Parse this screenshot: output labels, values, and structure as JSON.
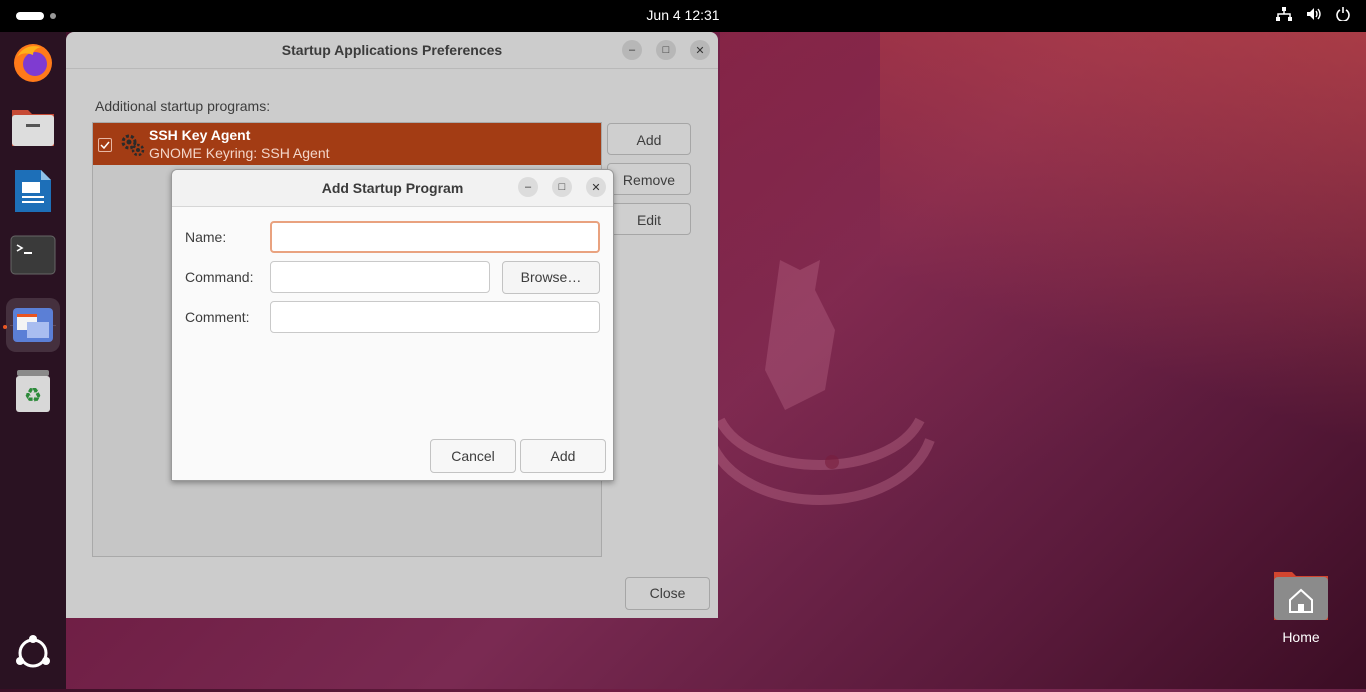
{
  "topbar": {
    "clock": "Jun 4  12:31",
    "tray_icons": [
      "network-icon",
      "volume-icon",
      "power-icon"
    ]
  },
  "dock": {
    "items": [
      {
        "name": "firefox-icon"
      },
      {
        "name": "files-icon"
      },
      {
        "name": "libreoffice-writer-icon"
      },
      {
        "name": "terminal-icon"
      },
      {
        "name": "startup-applications-icon",
        "running": true
      },
      {
        "name": "trash-icon"
      },
      {
        "name": "show-apps-icon"
      }
    ]
  },
  "main_window": {
    "title": "Startup Applications Preferences",
    "section_label": "Additional startup programs:",
    "programs": [
      {
        "name": "SSH Key Agent",
        "description": "GNOME Keyring: SSH Agent",
        "enabled": true,
        "selected": true
      }
    ],
    "buttons": {
      "add": "Add",
      "remove": "Remove",
      "edit": "Edit",
      "close": "Close"
    }
  },
  "dialog": {
    "title": "Add Startup Program",
    "name_label": "Name:",
    "command_label": "Command:",
    "comment_label": "Comment:",
    "name_value": "",
    "command_value": "",
    "comment_value": "",
    "browse_label": "Browse…",
    "cancel_label": "Cancel",
    "add_label": "Add"
  },
  "desktop": {
    "home_label": "Home"
  },
  "colors": {
    "accent": "#e95420",
    "selected_row": "#a33c14",
    "topbar": "#000000"
  }
}
